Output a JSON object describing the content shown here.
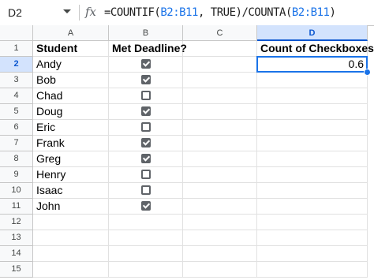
{
  "formula_bar": {
    "name_box": "D2",
    "fx_label": "fx",
    "formula_prefix": "=COUNTIF(",
    "formula_range1": "B2:B11",
    "formula_mid": ", TRUE)/COUNTA(",
    "formula_range2": "B2:B11",
    "formula_suffix": ")"
  },
  "columns": [
    "A",
    "B",
    "C",
    "D"
  ],
  "selected_column": "D",
  "rows": [
    "1",
    "2",
    "3",
    "4",
    "5",
    "6",
    "7",
    "8",
    "9",
    "10",
    "11",
    "12",
    "13",
    "14",
    "15"
  ],
  "selected_row": "2",
  "headers": {
    "student": "Student",
    "met_deadline": "Met Deadline?",
    "count_label": "Count of Checkboxes"
  },
  "result_value": "0.6",
  "students": [
    {
      "name": "Andy",
      "checked": true
    },
    {
      "name": "Bob",
      "checked": true
    },
    {
      "name": "Chad",
      "checked": false
    },
    {
      "name": "Doug",
      "checked": true
    },
    {
      "name": "Eric",
      "checked": false
    },
    {
      "name": "Frank",
      "checked": true
    },
    {
      "name": "Greg",
      "checked": true
    },
    {
      "name": "Henry",
      "checked": false
    },
    {
      "name": "Isaac",
      "checked": false
    },
    {
      "name": "John",
      "checked": true
    }
  ],
  "colors": {
    "accent": "#1a73e8",
    "checkbox": "#5f6368",
    "header_bg": "#f8f9fa",
    "selected_header_bg": "#d3e3fd"
  }
}
